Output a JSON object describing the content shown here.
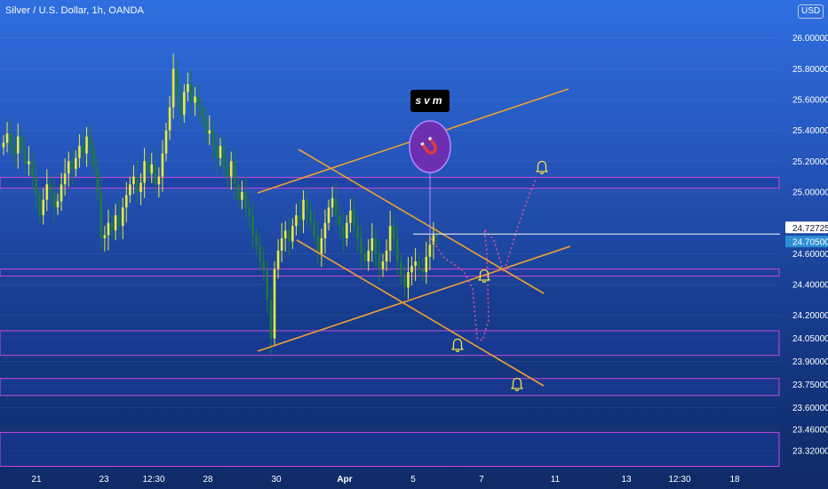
{
  "title": "Silver / U.S. Dollar, 1h, OANDA",
  "currency": "USD",
  "watermark": "svm",
  "colors": {
    "bg_top": "#2f6fe0",
    "bg_bottom": "#0f2a66",
    "candle_up": "#e6eb3c",
    "candle_down": "#1f7a3d",
    "trendline": "#f0a030",
    "zone_border": "#c54adb",
    "zone_fill": "#1b3a9a",
    "projection": "#e0509b",
    "alert": "#f0e14a",
    "price_label_bg": "#2b8fd6"
  },
  "chart_data": {
    "type": "candlestick",
    "symbol": "XAGUSD",
    "timeframe": "1h",
    "ylim": [
      23.2,
      26.2
    ],
    "y_ticks": [
      {
        "label": "26.00000",
        "value": 26.0
      },
      {
        "label": "25.80000",
        "value": 25.8
      },
      {
        "label": "25.60000",
        "value": 25.6
      },
      {
        "label": "25.40000",
        "value": 25.4
      },
      {
        "label": "25.20000",
        "value": 25.2
      },
      {
        "label": "25.00000",
        "value": 25.0
      },
      {
        "label": "24.60000",
        "value": 24.6
      },
      {
        "label": "24.40000",
        "value": 24.4
      },
      {
        "label": "24.20000",
        "value": 24.2
      },
      {
        "label": "24.05000",
        "value": 24.05
      },
      {
        "label": "23.90000",
        "value": 23.9
      },
      {
        "label": "23.75000",
        "value": 23.75
      },
      {
        "label": "23.60000",
        "value": 23.6
      },
      {
        "label": "23.46000",
        "value": 23.46
      },
      {
        "label": "23.32000",
        "value": 23.32
      }
    ],
    "x_ticks": [
      "21",
      "23",
      "12:30",
      "28",
      "30",
      "Apr",
      "5",
      "7",
      "11",
      "13",
      "12:30",
      "18"
    ],
    "price_labels": [
      {
        "label": "24.72725",
        "value": 24.72725,
        "style": "outline"
      },
      {
        "label": "24.70500",
        "value": 24.705,
        "style": "filled"
      }
    ],
    "close_series": [
      25.32,
      25.38,
      25.3,
      25.25,
      25.36,
      25.28,
      25.18,
      25.2,
      25.1,
      24.98,
      24.85,
      24.95,
      25.05,
      25.0,
      24.9,
      24.94,
      25.05,
      25.12,
      25.2,
      25.15,
      25.22,
      25.3,
      25.25,
      25.36,
      25.28,
      25.15,
      25.0,
      24.7,
      24.72,
      24.8,
      24.75,
      24.85,
      24.78,
      24.9,
      24.98,
      25.05,
      25.1,
      25.0,
      25.06,
      25.2,
      25.12,
      25.18,
      25.05,
      25.1,
      25.25,
      25.4,
      25.55,
      25.8,
      25.62,
      25.5,
      25.65,
      25.7,
      25.58,
      25.62,
      25.55,
      25.48,
      25.38,
      25.4,
      25.3,
      25.22,
      25.3,
      25.15,
      25.1,
      25.2,
      25.05,
      24.95,
      25.0,
      24.9,
      24.85,
      24.72,
      24.65,
      24.55,
      24.5,
      24.3,
      24.05,
      24.5,
      24.62,
      24.7,
      24.75,
      24.68,
      24.78,
      24.85,
      24.82,
      24.95,
      24.88,
      24.8,
      24.72,
      24.6,
      24.7,
      24.8,
      24.9,
      24.96,
      24.85,
      24.78,
      24.7,
      24.8,
      24.88,
      24.78,
      24.7,
      24.6,
      24.55,
      24.62,
      24.7,
      24.6,
      24.5,
      24.55,
      24.62,
      24.78,
      24.7,
      24.55,
      24.45,
      24.38,
      24.48,
      24.52,
      24.55,
      24.5,
      24.48,
      24.58,
      24.66,
      24.72,
      24.705
    ],
    "drawings": {
      "zones": [
        {
          "top": 25.095,
          "bottom": 25.025
        },
        {
          "top": 24.5,
          "bottom": 24.455
        },
        {
          "top": 24.1,
          "bottom": 23.94
        },
        {
          "top": 23.79,
          "bottom": 23.68
        },
        {
          "top": 23.44,
          "bottom": 23.22
        }
      ],
      "trendlines": [
        {
          "from": [
            290,
            217
          ],
          "to": [
            640,
            100
          ]
        },
        {
          "from": [
            336,
            168
          ],
          "to": [
            612,
            330
          ]
        },
        {
          "from": [
            290,
            395
          ],
          "to": [
            642,
            277
          ]
        },
        {
          "from": [
            334,
            270
          ],
          "to": [
            612,
            434
          ]
        }
      ],
      "projection_path": [
        [
          485,
          268
        ],
        [
          500,
          290
        ],
        [
          522,
          305
        ],
        [
          532,
          325
        ],
        [
          537,
          380
        ],
        [
          543,
          383
        ],
        [
          550,
          360
        ],
        [
          548,
          282
        ],
        [
          545,
          258
        ],
        [
          556,
          270
        ],
        [
          567,
          306
        ],
        [
          582,
          258
        ],
        [
          596,
          218
        ],
        [
          604,
          200
        ]
      ],
      "alerts": [
        [
          610,
          188
        ],
        [
          545,
          310
        ],
        [
          515,
          388
        ],
        [
          582,
          432
        ]
      ]
    }
  }
}
